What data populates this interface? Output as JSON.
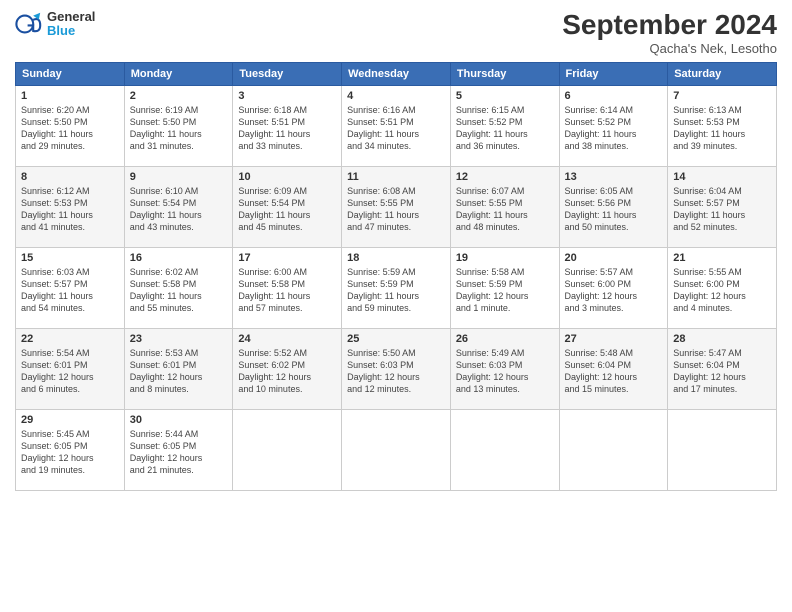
{
  "header": {
    "logo_text_line1": "General",
    "logo_text_line2": "Blue",
    "month_title": "September 2024",
    "location": "Qacha's Nek, Lesotho"
  },
  "weekdays": [
    "Sunday",
    "Monday",
    "Tuesday",
    "Wednesday",
    "Thursday",
    "Friday",
    "Saturday"
  ],
  "weeks": [
    [
      {
        "day": "1",
        "lines": [
          "Sunrise: 6:20 AM",
          "Sunset: 5:50 PM",
          "Daylight: 11 hours",
          "and 29 minutes."
        ]
      },
      {
        "day": "2",
        "lines": [
          "Sunrise: 6:19 AM",
          "Sunset: 5:50 PM",
          "Daylight: 11 hours",
          "and 31 minutes."
        ]
      },
      {
        "day": "3",
        "lines": [
          "Sunrise: 6:18 AM",
          "Sunset: 5:51 PM",
          "Daylight: 11 hours",
          "and 33 minutes."
        ]
      },
      {
        "day": "4",
        "lines": [
          "Sunrise: 6:16 AM",
          "Sunset: 5:51 PM",
          "Daylight: 11 hours",
          "and 34 minutes."
        ]
      },
      {
        "day": "5",
        "lines": [
          "Sunrise: 6:15 AM",
          "Sunset: 5:52 PM",
          "Daylight: 11 hours",
          "and 36 minutes."
        ]
      },
      {
        "day": "6",
        "lines": [
          "Sunrise: 6:14 AM",
          "Sunset: 5:52 PM",
          "Daylight: 11 hours",
          "and 38 minutes."
        ]
      },
      {
        "day": "7",
        "lines": [
          "Sunrise: 6:13 AM",
          "Sunset: 5:53 PM",
          "Daylight: 11 hours",
          "and 39 minutes."
        ]
      }
    ],
    [
      {
        "day": "8",
        "lines": [
          "Sunrise: 6:12 AM",
          "Sunset: 5:53 PM",
          "Daylight: 11 hours",
          "and 41 minutes."
        ]
      },
      {
        "day": "9",
        "lines": [
          "Sunrise: 6:10 AM",
          "Sunset: 5:54 PM",
          "Daylight: 11 hours",
          "and 43 minutes."
        ]
      },
      {
        "day": "10",
        "lines": [
          "Sunrise: 6:09 AM",
          "Sunset: 5:54 PM",
          "Daylight: 11 hours",
          "and 45 minutes."
        ]
      },
      {
        "day": "11",
        "lines": [
          "Sunrise: 6:08 AM",
          "Sunset: 5:55 PM",
          "Daylight: 11 hours",
          "and 47 minutes."
        ]
      },
      {
        "day": "12",
        "lines": [
          "Sunrise: 6:07 AM",
          "Sunset: 5:55 PM",
          "Daylight: 11 hours",
          "and 48 minutes."
        ]
      },
      {
        "day": "13",
        "lines": [
          "Sunrise: 6:05 AM",
          "Sunset: 5:56 PM",
          "Daylight: 11 hours",
          "and 50 minutes."
        ]
      },
      {
        "day": "14",
        "lines": [
          "Sunrise: 6:04 AM",
          "Sunset: 5:57 PM",
          "Daylight: 11 hours",
          "and 52 minutes."
        ]
      }
    ],
    [
      {
        "day": "15",
        "lines": [
          "Sunrise: 6:03 AM",
          "Sunset: 5:57 PM",
          "Daylight: 11 hours",
          "and 54 minutes."
        ]
      },
      {
        "day": "16",
        "lines": [
          "Sunrise: 6:02 AM",
          "Sunset: 5:58 PM",
          "Daylight: 11 hours",
          "and 55 minutes."
        ]
      },
      {
        "day": "17",
        "lines": [
          "Sunrise: 6:00 AM",
          "Sunset: 5:58 PM",
          "Daylight: 11 hours",
          "and 57 minutes."
        ]
      },
      {
        "day": "18",
        "lines": [
          "Sunrise: 5:59 AM",
          "Sunset: 5:59 PM",
          "Daylight: 11 hours",
          "and 59 minutes."
        ]
      },
      {
        "day": "19",
        "lines": [
          "Sunrise: 5:58 AM",
          "Sunset: 5:59 PM",
          "Daylight: 12 hours",
          "and 1 minute."
        ]
      },
      {
        "day": "20",
        "lines": [
          "Sunrise: 5:57 AM",
          "Sunset: 6:00 PM",
          "Daylight: 12 hours",
          "and 3 minutes."
        ]
      },
      {
        "day": "21",
        "lines": [
          "Sunrise: 5:55 AM",
          "Sunset: 6:00 PM",
          "Daylight: 12 hours",
          "and 4 minutes."
        ]
      }
    ],
    [
      {
        "day": "22",
        "lines": [
          "Sunrise: 5:54 AM",
          "Sunset: 6:01 PM",
          "Daylight: 12 hours",
          "and 6 minutes."
        ]
      },
      {
        "day": "23",
        "lines": [
          "Sunrise: 5:53 AM",
          "Sunset: 6:01 PM",
          "Daylight: 12 hours",
          "and 8 minutes."
        ]
      },
      {
        "day": "24",
        "lines": [
          "Sunrise: 5:52 AM",
          "Sunset: 6:02 PM",
          "Daylight: 12 hours",
          "and 10 minutes."
        ]
      },
      {
        "day": "25",
        "lines": [
          "Sunrise: 5:50 AM",
          "Sunset: 6:03 PM",
          "Daylight: 12 hours",
          "and 12 minutes."
        ]
      },
      {
        "day": "26",
        "lines": [
          "Sunrise: 5:49 AM",
          "Sunset: 6:03 PM",
          "Daylight: 12 hours",
          "and 13 minutes."
        ]
      },
      {
        "day": "27",
        "lines": [
          "Sunrise: 5:48 AM",
          "Sunset: 6:04 PM",
          "Daylight: 12 hours",
          "and 15 minutes."
        ]
      },
      {
        "day": "28",
        "lines": [
          "Sunrise: 5:47 AM",
          "Sunset: 6:04 PM",
          "Daylight: 12 hours",
          "and 17 minutes."
        ]
      }
    ],
    [
      {
        "day": "29",
        "lines": [
          "Sunrise: 5:45 AM",
          "Sunset: 6:05 PM",
          "Daylight: 12 hours",
          "and 19 minutes."
        ]
      },
      {
        "day": "30",
        "lines": [
          "Sunrise: 5:44 AM",
          "Sunset: 6:05 PM",
          "Daylight: 12 hours",
          "and 21 minutes."
        ]
      },
      {
        "day": "",
        "lines": []
      },
      {
        "day": "",
        "lines": []
      },
      {
        "day": "",
        "lines": []
      },
      {
        "day": "",
        "lines": []
      },
      {
        "day": "",
        "lines": []
      }
    ]
  ]
}
